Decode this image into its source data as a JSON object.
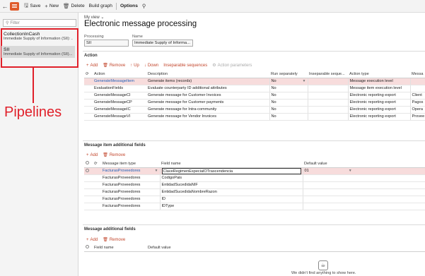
{
  "toolbar": {
    "save_label": "Save",
    "new_label": "New",
    "delete_label": "Delete",
    "build_graph_label": "Build graph",
    "options_label": "Options"
  },
  "left_pane": {
    "filter_placeholder": "Filter",
    "items": [
      {
        "title": "CollectionInCash",
        "subtitle": "Immediate Supply of Information (SII): ..."
      },
      {
        "title": "SII",
        "subtitle": "Immediate Supply of Information (SII)..."
      }
    ],
    "annotation_label": "Pipelines",
    "annotation_color": "#e0202a"
  },
  "page": {
    "view_label": "My view",
    "title": "Electronic message processing",
    "processing_label": "Processing",
    "processing_value": "SII",
    "name_label": "Name",
    "name_value": "Immediate Supply of Informa..."
  },
  "action_section": {
    "title": "Action",
    "toolbar": {
      "add": "Add",
      "remove": "Remove",
      "up": "Up",
      "down": "Down",
      "inseparable": "Inseparable sequences",
      "parameters": "Action parameters"
    },
    "columns": [
      "Action",
      "Description",
      "Run separately",
      "Inseparable seque...",
      "Action type",
      "Messa"
    ],
    "rows": [
      {
        "action": "GenerateMessageItem",
        "description": "Generate items (records)",
        "run_separately": "No",
        "inseparable": "",
        "action_type": "Message execution level",
        "message": ""
      },
      {
        "action": "EvaluationFields",
        "description": "Evaluate counterparty ID additional attributes",
        "run_separately": "No",
        "inseparable": "",
        "action_type": "Message item execution level",
        "message": ""
      },
      {
        "action": "GenerateMessageCI",
        "description": "Generate message for Customer Invoices",
        "run_separately": "No",
        "inseparable": "",
        "action_type": "Electronic reporting export",
        "message": "Client"
      },
      {
        "action": "GenerateMessageCP",
        "description": "Generate message for Customer payments",
        "run_separately": "No",
        "inseparable": "",
        "action_type": "Electronic reporting export",
        "message": "Pagos"
      },
      {
        "action": "GenerateMessageIC",
        "description": "Generate message for Intra-community",
        "run_separately": "No",
        "inseparable": "",
        "action_type": "Electronic reporting export",
        "message": "Opera"
      },
      {
        "action": "GenerateMessageVI",
        "description": "Generate message for Vendor Invoices",
        "run_separately": "No",
        "inseparable": "",
        "action_type": "Electronic reporting export",
        "message": "Provee"
      }
    ]
  },
  "item_fields_section": {
    "title": "Message item additional fields",
    "toolbar": {
      "add": "Add",
      "remove": "Remove"
    },
    "columns": [
      "Message item type",
      "Field name",
      "Default value"
    ],
    "rows": [
      {
        "type": "FacturasProveedores",
        "field": "ClaveRegimenEspecialOTrascendencia",
        "default": "01"
      },
      {
        "type": "FacturasProveedores",
        "field": "CodigoPais",
        "default": ""
      },
      {
        "type": "FacturasProveedores",
        "field": "EntidadSucedidaNIF",
        "default": ""
      },
      {
        "type": "FacturasProveedores",
        "field": "EntidadSucedidaNombreRazon",
        "default": ""
      },
      {
        "type": "FacturasProveedores",
        "field": "ID",
        "default": ""
      },
      {
        "type": "FacturasProveedores",
        "field": "IDType",
        "default": ""
      }
    ]
  },
  "message_fields_section": {
    "title": "Message additional fields",
    "toolbar": {
      "add": "Add",
      "remove": "Remove"
    },
    "columns": [
      "Field name",
      "Default value"
    ],
    "empty_text": "We didn't find anything to show here."
  },
  "colors": {
    "accent": "#c2452b",
    "selected_row": "#f7dcdc",
    "link": "#1f5fb8",
    "menu_button": "#e05a2a"
  }
}
